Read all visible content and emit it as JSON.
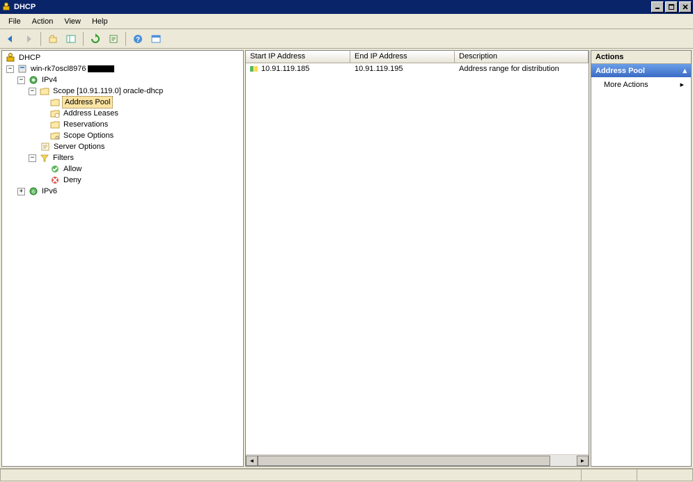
{
  "window": {
    "title": "DHCP"
  },
  "menu": {
    "file": "File",
    "action": "Action",
    "view": "View",
    "help": "Help"
  },
  "tree": {
    "root": "DHCP",
    "server": "win-rk7oscl8976",
    "ipv4": "IPv4",
    "scope": "Scope [10.91.119.0] oracle-dhcp",
    "address_pool": "Address Pool",
    "address_leases": "Address Leases",
    "reservations": "Reservations",
    "scope_options": "Scope Options",
    "server_options": "Server Options",
    "filters": "Filters",
    "allow": "Allow",
    "deny": "Deny",
    "ipv6": "IPv6"
  },
  "list": {
    "columns": {
      "start": "Start IP Address",
      "end": "End IP Address",
      "desc": "Description"
    },
    "rows": [
      {
        "start": "10.91.119.185",
        "end": "10.91.119.195",
        "desc": "Address range for distribution"
      }
    ]
  },
  "actions": {
    "title": "Actions",
    "context": "Address Pool",
    "more": "More Actions"
  }
}
